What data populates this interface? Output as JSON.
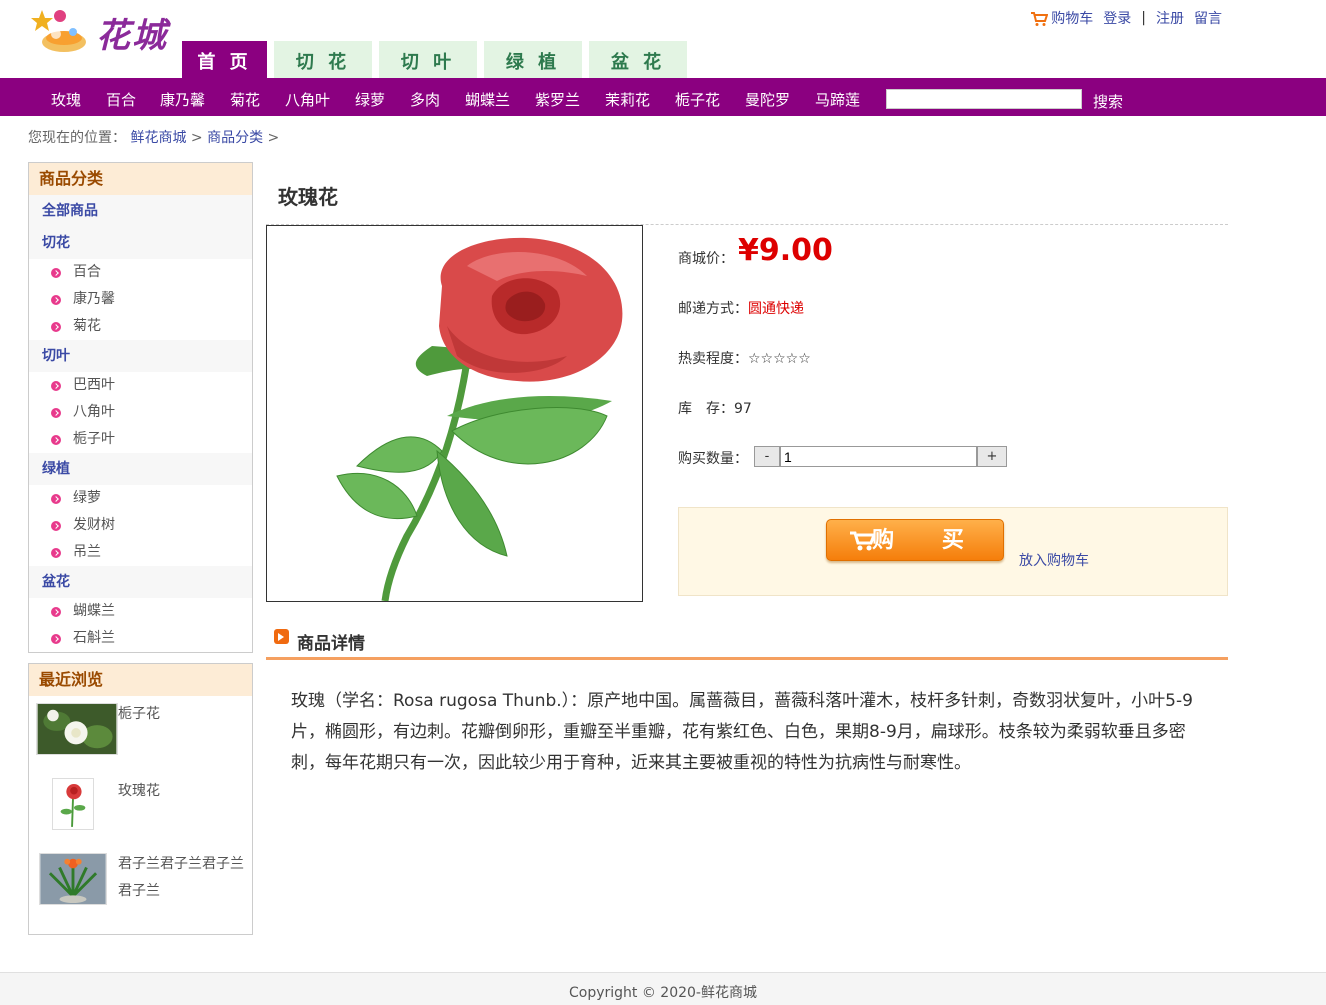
{
  "header": {
    "logo_text": "花城",
    "links": {
      "cart": "购物车",
      "login": "登录",
      "sep": "|",
      "register": "注册",
      "message": "留言"
    },
    "tabs": [
      "首 页",
      "切 花",
      "切 叶",
      "绿 植",
      "盆 花"
    ]
  },
  "nav": {
    "items": [
      "玫瑰",
      "百合",
      "康乃馨",
      "菊花",
      "八角叶",
      "绿萝",
      "多肉",
      "蝴蝶兰",
      "紫罗兰",
      "茉莉花",
      "栀子花",
      "曼陀罗",
      "马蹄莲"
    ],
    "search_button": "搜索",
    "search_value": ""
  },
  "breadcrumb": {
    "prefix": "您现在的位置：",
    "home": "鲜花商城",
    "sep": ">",
    "category": "商品分类"
  },
  "sidebar": {
    "categories_title": "商品分类",
    "all_label": "全部商品",
    "groups": [
      {
        "name": "切花",
        "items": [
          "百合",
          "康乃馨",
          "菊花"
        ]
      },
      {
        "name": "切叶",
        "items": [
          "巴西叶",
          "八角叶",
          "栀子叶"
        ]
      },
      {
        "name": "绿植",
        "items": [
          "绿萝",
          "发财树",
          "吊兰"
        ]
      },
      {
        "name": "盆花",
        "items": [
          "蝴蝶兰",
          "石斛兰"
        ]
      }
    ],
    "recent_title": "最近浏览",
    "recent": [
      {
        "name": "栀子花",
        "icon": "gardenia-thumbnail"
      },
      {
        "name": "玫瑰花",
        "icon": "rose-thumbnail"
      },
      {
        "name": "君子兰君子兰君子兰君子兰",
        "icon": "clivia-thumbnail"
      }
    ]
  },
  "product": {
    "title": "玫瑰花",
    "price_label": "商城价：",
    "price": "¥9.00",
    "shipping_label": "邮递方式：",
    "shipping": "圆通快递",
    "popularity_label": "热卖程度：",
    "popularity_stars": "☆☆☆☆☆",
    "stock_label": "库　存：",
    "stock": "97",
    "qty_label": "购买数量：",
    "qty_minus": "-",
    "qty_value": "1",
    "qty_plus": "+",
    "buy_label": "购 买",
    "add_cart_label": "放入购物车"
  },
  "detail": {
    "title": "商品详情",
    "text": "玫瑰（学名：Rosa rugosa Thunb.）：原产地中国。属蔷薇目，蔷薇科落叶灌木，枝杆多针刺，奇数羽状复叶，小叶5-9片，椭圆形，有边刺。花瓣倒卵形，重瓣至半重瓣，花有紫红色、白色，果期8-9月，扁球形。枝条较为柔弱软垂且多密刺，每年花期只有一次，因此较少用于育种，近来其主要被重视的特性为抗病性与耐寒性。"
  },
  "footer": {
    "copyright": "Copyright © 2020-鲜花商城"
  },
  "colors": {
    "brand": "#8b0080",
    "price": "#dd0000",
    "accent_orange": "#f57e0b",
    "link": "#3b4aa5"
  }
}
